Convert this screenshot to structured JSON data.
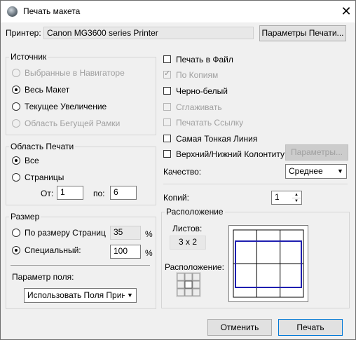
{
  "window": {
    "title": "Печать макета"
  },
  "printer": {
    "label": "Принтер:",
    "value": "Canon MG3600 series Printer",
    "settings_button": "Параметры Печати..."
  },
  "source": {
    "legend": "Источник",
    "options": [
      {
        "label": "Выбранные в Навигаторе",
        "selected": false,
        "enabled": false
      },
      {
        "label": "Весь Макет",
        "selected": true,
        "enabled": true
      },
      {
        "label": "Текущее Увеличение",
        "selected": false,
        "enabled": true
      },
      {
        "label": "Область Бегущей Рамки",
        "selected": false,
        "enabled": false
      }
    ]
  },
  "print_area": {
    "legend": "Область Печати",
    "all_label": "Все",
    "pages_label": "Страницы",
    "from_label": "От:",
    "from_value": "1",
    "to_label": "по:",
    "to_value": "6"
  },
  "size": {
    "legend": "Размер",
    "fit_label": "По размеру Страниц",
    "fit_value": "35",
    "custom_label": "Специальный:",
    "custom_value": "100",
    "percent": "%",
    "margin_label": "Параметр поля:",
    "margin_value": "Использовать Поля Принт"
  },
  "options": {
    "print_to_file": "Печать в Файл",
    "collate": "По Копиям",
    "black_white": "Черно-белый",
    "smooth": "Сглаживать",
    "print_link": "Печатать Ссылку",
    "thinnest_line": "Самая Тонкая Линия",
    "header_footer": "Верхний/Нижний Колонтиту",
    "params_button": "Параметры...",
    "quality_label": "Качество:",
    "quality_value": "Среднее",
    "copies_label": "Копий:",
    "copies_value": "1"
  },
  "layout": {
    "legend": "Расположение",
    "sheets_label": "Листов:",
    "sheets_value": "3 x 2",
    "position_label": "Расположение:"
  },
  "footer": {
    "cancel": "Отменить",
    "print": "Печать"
  }
}
